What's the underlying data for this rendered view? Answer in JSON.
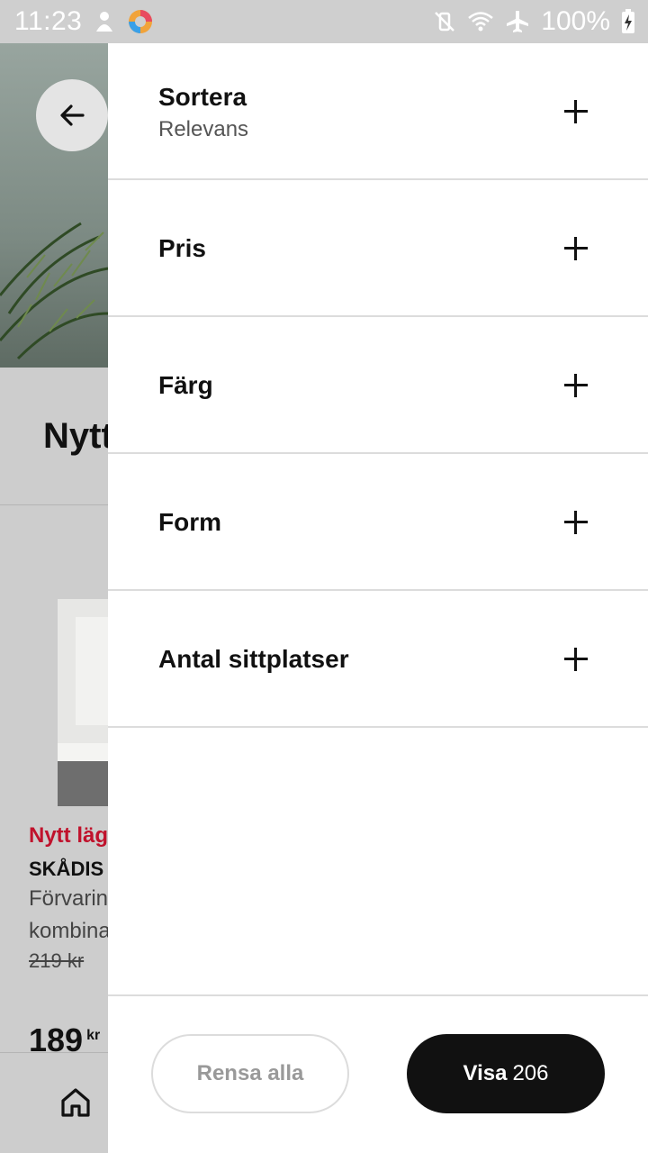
{
  "status_bar": {
    "time": "11:23",
    "battery": "100%"
  },
  "background_page": {
    "title_partial": "Nytt",
    "product": {
      "new_label": "Nytt lägre pris",
      "name": "SKÅDIS",
      "desc_line1": "Förvaring",
      "desc_line2": "kombination",
      "old_price": "219 kr",
      "price": "189",
      "currency": "kr"
    }
  },
  "filters": [
    {
      "label": "Sortera",
      "value": "Relevans"
    },
    {
      "label": "Pris"
    },
    {
      "label": "Färg"
    },
    {
      "label": "Form"
    },
    {
      "label": "Antal sittplatser"
    }
  ],
  "footer": {
    "clear_label": "Rensa alla",
    "show_label": "Visa",
    "show_count": "206"
  },
  "colors": {
    "accent_dark": "#111111",
    "sale_red": "#c0122c"
  }
}
